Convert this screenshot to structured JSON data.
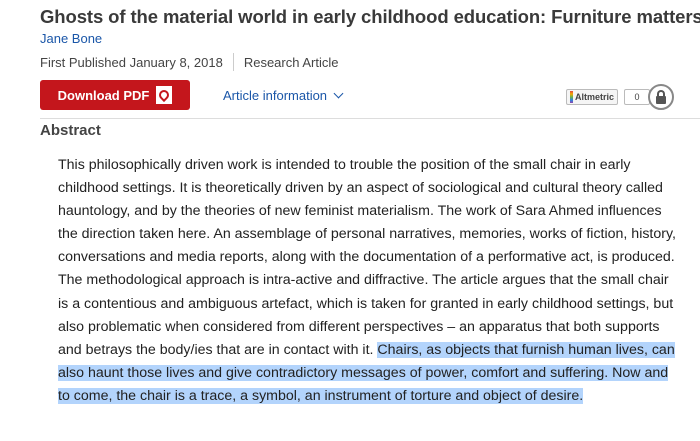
{
  "article": {
    "title": "Ghosts of the material world in early childhood education: Furniture matters",
    "author": "Jane Bone",
    "published": "First Published January 8, 2018",
    "type": "Research Article"
  },
  "actions": {
    "download_label": "Download PDF",
    "download_icon": "pdf-icon",
    "article_info_label": "Article information",
    "altmetric_label": "Altmetric",
    "altmetric_count": "0",
    "lock_icon": "lock-icon"
  },
  "abstract": {
    "heading": "Abstract",
    "text": "This philosophically driven work is intended to trouble the position of the small chair in early childhood settings. It is theoretically driven by an aspect of sociological and cultural theory called hauntology, and by the theories of new feminist materialism. The work of Sara Ahmed influences the direction taken here. An assemblage of personal narratives, memories, works of fiction, history, conversations and media reports, along with the documentation of a performative act, is produced. The methodological approach is intra-active and diffractive. The article argues that the small chair is a contentious and ambiguous artefact, which is taken for granted in early childhood settings, but also problematic when considered from different perspectives – an apparatus that both supports and betrays the body/ies that are in contact with it.",
    "highlighted_text": "Chairs, as objects that furnish human lives, can also haunt those lives and give contradictory messages of power, comfort and suffering. Now and to come, the chair is a trace, a symbol, an instrument of torture and object of desire.",
    "highlight_color": "#b3d4fc"
  },
  "colors": {
    "download_button": "#c4161c",
    "link": "#1a56a8"
  }
}
